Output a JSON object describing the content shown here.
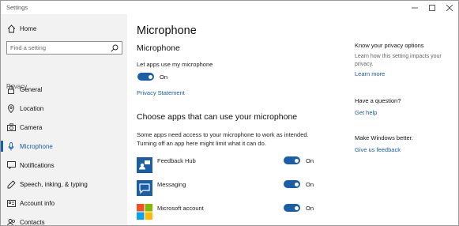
{
  "window": {
    "title": "Settings"
  },
  "sidebar": {
    "home_label": "Home",
    "search_placeholder": "Find a setting",
    "section_label": "Privacy",
    "items": [
      {
        "label": "General",
        "icon": "lock-icon"
      },
      {
        "label": "Location",
        "icon": "location-pin-icon"
      },
      {
        "label": "Camera",
        "icon": "camera-icon"
      },
      {
        "label": "Microphone",
        "icon": "microphone-icon",
        "active": true
      },
      {
        "label": "Notifications",
        "icon": "notifications-icon"
      },
      {
        "label": "Speech, inking, & typing",
        "icon": "speech-icon"
      },
      {
        "label": "Account info",
        "icon": "account-info-icon"
      },
      {
        "label": "Contacts",
        "icon": "contacts-icon"
      }
    ]
  },
  "main": {
    "page_title": "Microphone",
    "section_title": "Microphone",
    "allow_label": "Let apps use my microphone",
    "allow_toggle_state": "On",
    "privacy_statement_link": "Privacy Statement",
    "apps_heading": "Choose apps that can use your microphone",
    "apps_description_line1": "Some apps need access to your microphone to work as intended.",
    "apps_description_line2": "Turning off an app here might limit what it can do.",
    "apps": [
      {
        "name": "Feedback Hub",
        "state": "On",
        "tile_color": "#1a5ea6"
      },
      {
        "name": "Messaging",
        "state": "On",
        "tile_color": "#1a5ea6"
      },
      {
        "name": "Microsoft account",
        "state": "On"
      }
    ]
  },
  "right_panel": {
    "privacy_heading": "Know your privacy options",
    "privacy_text": "Learn how this setting impacts your",
    "privacy_text2": "privacy.",
    "learn_more_link": "Learn more",
    "question_heading": "Have a question?",
    "get_help_link": "Get help",
    "better_heading": "Make Windows better.",
    "feedback_link": "Give us feedback"
  },
  "colors": {
    "accent": "#1a5ea6",
    "sidebar_bg": "#f2f2f2"
  }
}
